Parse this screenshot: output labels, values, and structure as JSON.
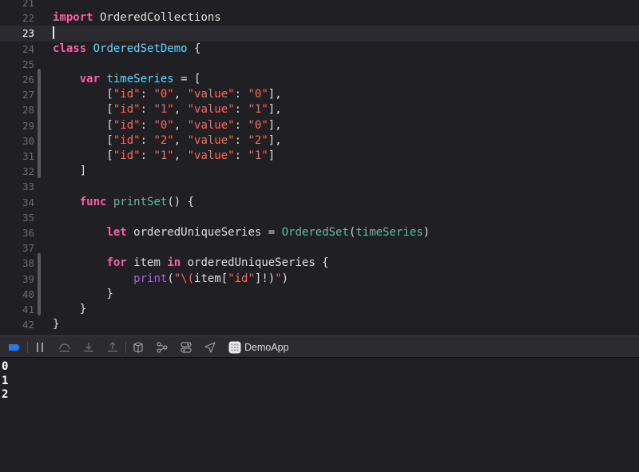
{
  "editor": {
    "lines": [
      {
        "num": "21",
        "tokens": []
      },
      {
        "num": "22",
        "tokens": [
          {
            "t": "import",
            "c": "kw"
          },
          {
            "t": " OrderedCollections",
            "c": "mod"
          }
        ]
      },
      {
        "num": "23",
        "tokens": [],
        "current": true
      },
      {
        "num": "24",
        "tokens": [
          {
            "t": "class",
            "c": "kw"
          },
          {
            "t": " ",
            "c": "plain"
          },
          {
            "t": "OrderedSetDemo",
            "c": "ty"
          },
          {
            "t": " {",
            "c": "plain"
          }
        ]
      },
      {
        "num": "25",
        "tokens": []
      },
      {
        "num": "26",
        "tokens": [
          {
            "t": "    ",
            "c": "plain"
          },
          {
            "t": "var",
            "c": "kw"
          },
          {
            "t": " ",
            "c": "plain"
          },
          {
            "t": "timeSeries",
            "c": "ty"
          },
          {
            "t": " = [",
            "c": "plain"
          }
        ]
      },
      {
        "num": "27",
        "tokens": [
          {
            "t": "        [",
            "c": "plain"
          },
          {
            "t": "\"id\"",
            "c": "str"
          },
          {
            "t": ": ",
            "c": "plain"
          },
          {
            "t": "\"0\"",
            "c": "str"
          },
          {
            "t": ", ",
            "c": "plain"
          },
          {
            "t": "\"value\"",
            "c": "str"
          },
          {
            "t": ": ",
            "c": "plain"
          },
          {
            "t": "\"0\"",
            "c": "str"
          },
          {
            "t": "],",
            "c": "plain"
          }
        ]
      },
      {
        "num": "28",
        "tokens": [
          {
            "t": "        [",
            "c": "plain"
          },
          {
            "t": "\"id\"",
            "c": "str"
          },
          {
            "t": ": ",
            "c": "plain"
          },
          {
            "t": "\"1\"",
            "c": "str"
          },
          {
            "t": ", ",
            "c": "plain"
          },
          {
            "t": "\"value\"",
            "c": "str"
          },
          {
            "t": ": ",
            "c": "plain"
          },
          {
            "t": "\"1\"",
            "c": "str"
          },
          {
            "t": "],",
            "c": "plain"
          }
        ]
      },
      {
        "num": "29",
        "tokens": [
          {
            "t": "        [",
            "c": "plain"
          },
          {
            "t": "\"id\"",
            "c": "str"
          },
          {
            "t": ": ",
            "c": "plain"
          },
          {
            "t": "\"0\"",
            "c": "str"
          },
          {
            "t": ", ",
            "c": "plain"
          },
          {
            "t": "\"value\"",
            "c": "str"
          },
          {
            "t": ": ",
            "c": "plain"
          },
          {
            "t": "\"0\"",
            "c": "str"
          },
          {
            "t": "],",
            "c": "plain"
          }
        ]
      },
      {
        "num": "30",
        "tokens": [
          {
            "t": "        [",
            "c": "plain"
          },
          {
            "t": "\"id\"",
            "c": "str"
          },
          {
            "t": ": ",
            "c": "plain"
          },
          {
            "t": "\"2\"",
            "c": "str"
          },
          {
            "t": ", ",
            "c": "plain"
          },
          {
            "t": "\"value\"",
            "c": "str"
          },
          {
            "t": ": ",
            "c": "plain"
          },
          {
            "t": "\"2\"",
            "c": "str"
          },
          {
            "t": "],",
            "c": "plain"
          }
        ]
      },
      {
        "num": "31",
        "tokens": [
          {
            "t": "        [",
            "c": "plain"
          },
          {
            "t": "\"id\"",
            "c": "str"
          },
          {
            "t": ": ",
            "c": "plain"
          },
          {
            "t": "\"1\"",
            "c": "str"
          },
          {
            "t": ", ",
            "c": "plain"
          },
          {
            "t": "\"value\"",
            "c": "str"
          },
          {
            "t": ": ",
            "c": "plain"
          },
          {
            "t": "\"1\"",
            "c": "str"
          },
          {
            "t": "]",
            "c": "plain"
          }
        ]
      },
      {
        "num": "32",
        "tokens": [
          {
            "t": "    ]",
            "c": "plain"
          }
        ]
      },
      {
        "num": "33",
        "tokens": []
      },
      {
        "num": "34",
        "tokens": [
          {
            "t": "    ",
            "c": "plain"
          },
          {
            "t": "func",
            "c": "kw"
          },
          {
            "t": " ",
            "c": "plain"
          },
          {
            "t": "printSet",
            "c": "fn"
          },
          {
            "t": "() {",
            "c": "plain"
          }
        ]
      },
      {
        "num": "35",
        "tokens": []
      },
      {
        "num": "36",
        "tokens": [
          {
            "t": "        ",
            "c": "plain"
          },
          {
            "t": "let",
            "c": "kw"
          },
          {
            "t": " orderedUniqueSeries = ",
            "c": "plain"
          },
          {
            "t": "OrderedSet",
            "c": "prop"
          },
          {
            "t": "(",
            "c": "plain"
          },
          {
            "t": "timeSeries",
            "c": "prop"
          },
          {
            "t": ")",
            "c": "plain"
          }
        ]
      },
      {
        "num": "37",
        "tokens": []
      },
      {
        "num": "38",
        "tokens": [
          {
            "t": "        ",
            "c": "plain"
          },
          {
            "t": "for",
            "c": "kw"
          },
          {
            "t": " item ",
            "c": "plain"
          },
          {
            "t": "in",
            "c": "kw"
          },
          {
            "t": " orderedUniqueSeries {",
            "c": "plain"
          }
        ]
      },
      {
        "num": "39",
        "tokens": [
          {
            "t": "            ",
            "c": "plain"
          },
          {
            "t": "print",
            "c": "sys"
          },
          {
            "t": "(",
            "c": "plain"
          },
          {
            "t": "\"\\(",
            "c": "str"
          },
          {
            "t": "item[",
            "c": "plain"
          },
          {
            "t": "\"id\"",
            "c": "str"
          },
          {
            "t": "]!)",
            "c": "plain"
          },
          {
            "t": "\"",
            "c": "str"
          },
          {
            "t": ")",
            "c": "plain"
          }
        ]
      },
      {
        "num": "40",
        "tokens": [
          {
            "t": "        }",
            "c": "plain"
          }
        ]
      },
      {
        "num": "41",
        "tokens": [
          {
            "t": "    }",
            "c": "plain"
          }
        ]
      },
      {
        "num": "42",
        "tokens": [
          {
            "t": "}",
            "c": "plain"
          }
        ]
      }
    ]
  },
  "debug_bar": {
    "app_name": "DemoApp"
  },
  "console": {
    "output": [
      "0",
      "1",
      "2"
    ]
  },
  "colors": {
    "keyword": "#fc5fa3",
    "string": "#fc6a5d",
    "type": "#5dd8ff",
    "function": "#67b7a4",
    "system": "#a167e6",
    "accent": "#1e7cf2"
  }
}
